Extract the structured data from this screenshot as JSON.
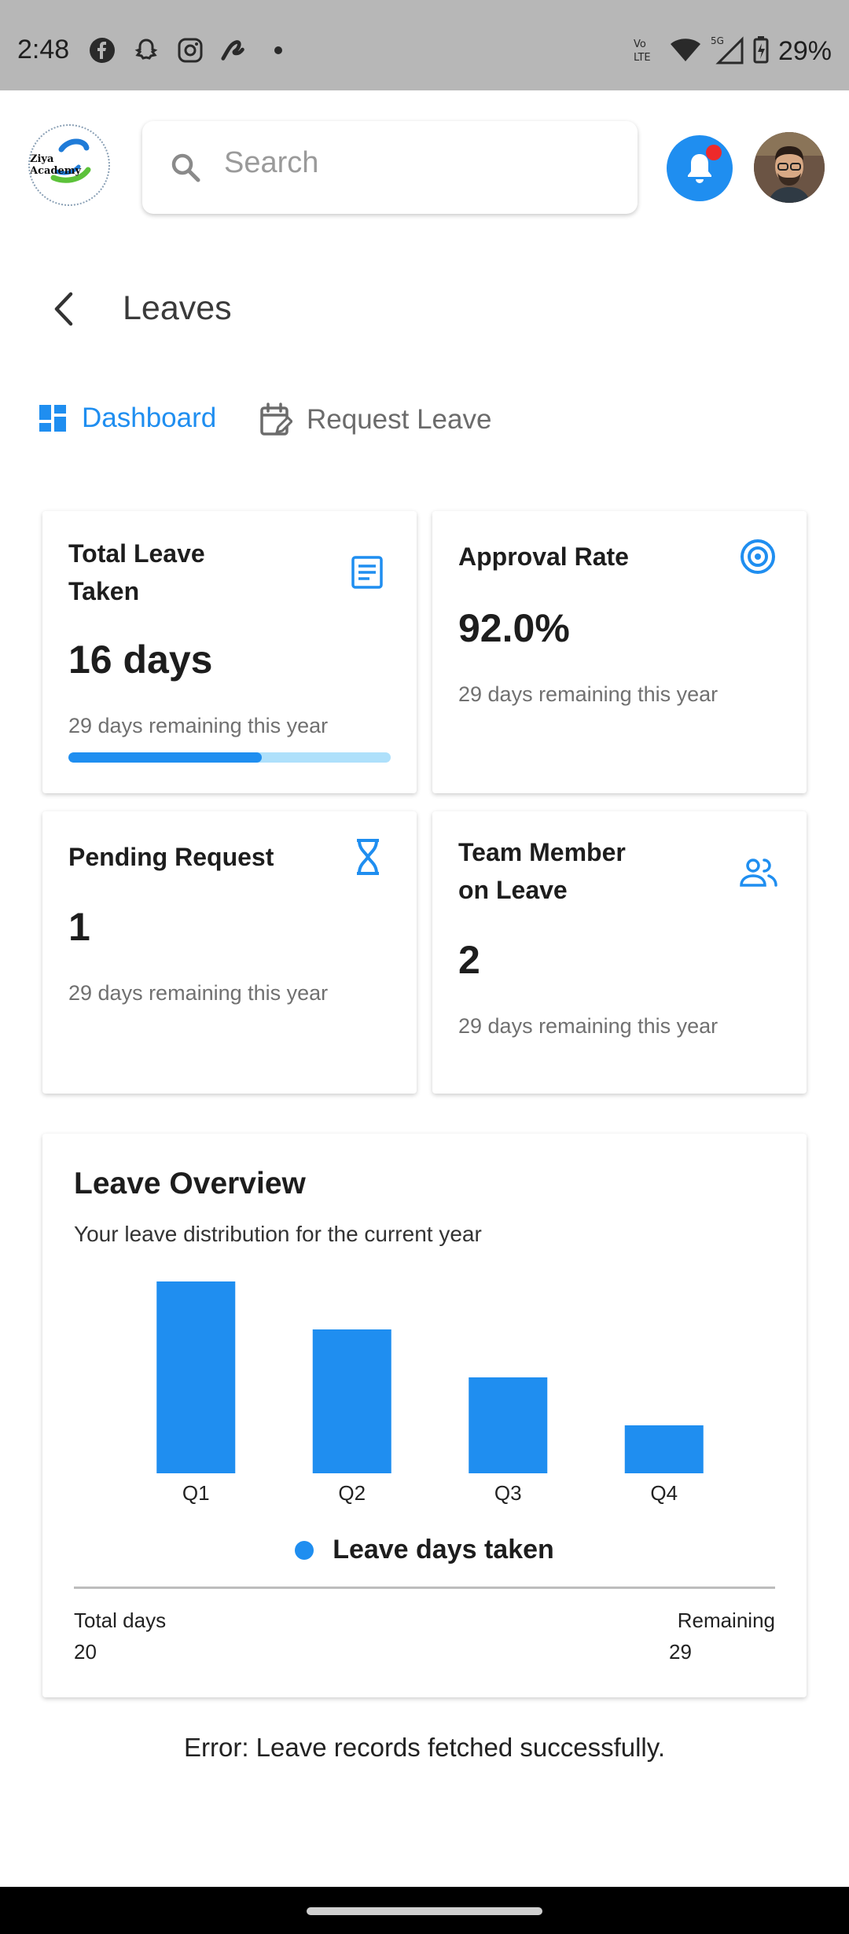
{
  "status_bar": {
    "time": "2:48",
    "battery": "29%",
    "network_label": "5G",
    "volte_label": "Vo LTE",
    "left_icons": [
      "facebook-icon",
      "snapchat-icon",
      "instagram-icon",
      "app-icon",
      "dot-icon"
    ]
  },
  "header": {
    "logo_text": "Ziya Academy",
    "search_placeholder": "Search"
  },
  "page": {
    "title": "Leaves"
  },
  "tabs": [
    {
      "label": "Dashboard",
      "active": true
    },
    {
      "label": "Request Leave",
      "active": false
    }
  ],
  "cards": {
    "total_leave": {
      "title_line1": "Total Leave",
      "title_line2": "Taken",
      "value": "16 days",
      "subtitle": "29 days remaining this year",
      "progress": 0.6,
      "icon": "document-icon"
    },
    "approval_rate": {
      "title": "Approval Rate",
      "value": "92.0%",
      "subtitle": "29 days remaining this year",
      "icon": "target-icon"
    },
    "pending": {
      "title": "Pending Request",
      "value": "1",
      "subtitle": "29 days remaining this year",
      "icon": "hourglass-icon"
    },
    "team_leave": {
      "title_line1": "Team Member",
      "title_line2": "on Leave",
      "value": "2",
      "subtitle": "29 days remaining this year",
      "icon": "people-icon"
    }
  },
  "overview": {
    "title": "Leave Overview",
    "subtitle": "Your leave distribution for the current year",
    "legend": "Leave days taken",
    "total_label": "Total days",
    "total_value": "20",
    "remaining_label": "Remaining",
    "remaining_value": "29"
  },
  "chart_data": {
    "type": "bar",
    "categories": [
      "Q1",
      "Q2",
      "Q3",
      "Q4"
    ],
    "series": [
      {
        "name": "Leave days taken",
        "values": [
          8,
          6,
          4,
          2
        ]
      }
    ],
    "ylim": [
      0,
      8
    ],
    "grid": false,
    "legend_position": "bottom",
    "color": "#1f8ef0"
  },
  "message": "Error: Leave records fetched successfully.",
  "colors": {
    "accent": "#1f8ef0",
    "progress_track": "#aee0fb",
    "notification_dot": "#ee2a2a"
  }
}
